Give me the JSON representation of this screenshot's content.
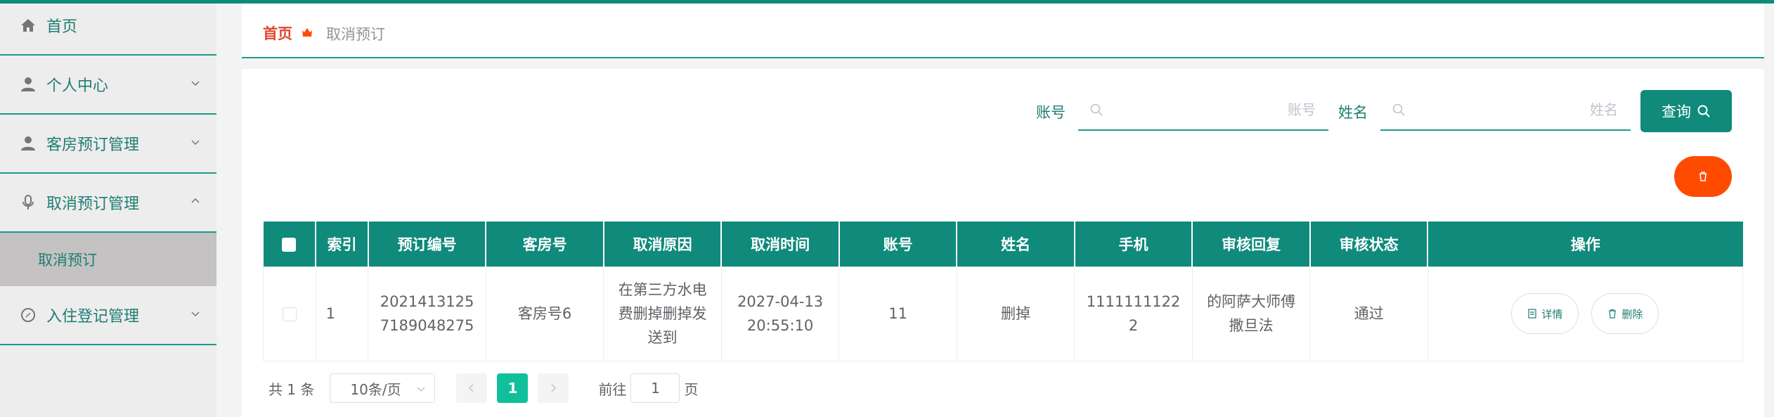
{
  "sidebar": {
    "items": [
      {
        "label": "首页",
        "icon": "home-icon"
      },
      {
        "label": "个人中心",
        "icon": "user-icon"
      },
      {
        "label": "客房预订管理",
        "icon": "user-icon"
      },
      {
        "label": "取消预订管理",
        "icon": "microphone-icon"
      },
      {
        "label": "入住登记管理",
        "icon": "compass-icon"
      }
    ],
    "submenu_active": "取消预订"
  },
  "breadcrumb": {
    "home": "首页",
    "current": "取消预订"
  },
  "search": {
    "account_label": "账号",
    "account_placeholder": "账号",
    "name_label": "姓名",
    "name_placeholder": "姓名",
    "query_button": "查询"
  },
  "table": {
    "headers": [
      "索引",
      "预订编号",
      "客房号",
      "取消原因",
      "取消时间",
      "账号",
      "姓名",
      "手机",
      "审核回复",
      "审核状态",
      "操作"
    ],
    "rows": [
      {
        "index": "1",
        "booking_no": "20214131257189048275",
        "room_no": "客房号6",
        "reason": "在第三方水电费删掉删掉发送到",
        "time": "2027-04-13 20:55:10",
        "account": "11",
        "name": "删掉",
        "phone": "11111111222",
        "reply": "的阿萨大师傅撒旦法",
        "status": "通过",
        "detail_btn": "详情",
        "delete_btn": "删除"
      }
    ]
  },
  "pagination": {
    "total": "共 1 条",
    "page_size": "10条/页",
    "current_page": "1",
    "goto_prefix": "前往",
    "goto_value": "1",
    "goto_suffix": "页"
  },
  "colors": {
    "accent": "#0f8a7b",
    "danger": "#ff4b00",
    "active_page": "#10c09b",
    "breadcrumb_home": "#e0462d"
  }
}
